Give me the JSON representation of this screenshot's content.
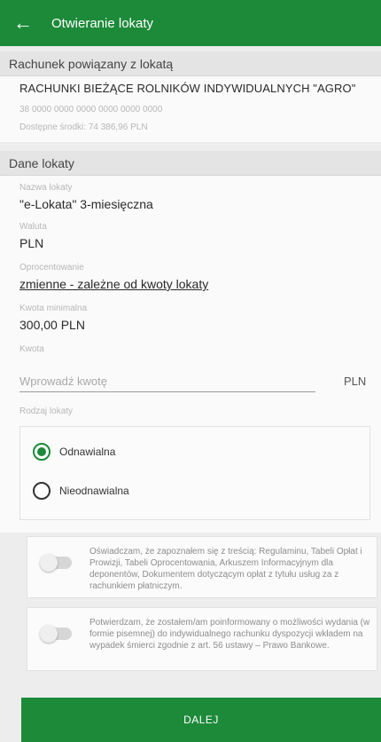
{
  "header": {
    "title": "Otwieranie lokaty",
    "back_icon": "arrow-left-icon"
  },
  "account_section": {
    "heading": "Rachunek powiązany z lokatą",
    "account_name": "RACHUNKI BIEŻĄCE ROLNIKÓW INDYWIDUALNYCH \"AGRO\"",
    "account_number": "38 0000 0000 0000 0000 0000 0000",
    "available_funds": "Dostępne środki: 74 386,96 PLN"
  },
  "deposit_section": {
    "heading": "Dane lokaty",
    "name_label": "Nazwa lokaty",
    "name_value": "\"e-Lokata\" 3-miesięczna",
    "currency_label": "Waluta",
    "currency_value": "PLN",
    "interest_label": "Oprocentowanie",
    "interest_value": "zmienne - zależne od kwoty lokaty",
    "min_amount_label": "Kwota minimalna",
    "min_amount_value": "300,00 PLN",
    "amount_label": "Kwota",
    "amount_placeholder": "Wprowadź kwotę",
    "amount_currency": "PLN",
    "type_label": "Rodzaj lokaty",
    "types": [
      {
        "label": "Odnawialna",
        "selected": true
      },
      {
        "label": "Nieodnawialna",
        "selected": false
      }
    ]
  },
  "consents": [
    {
      "text": "Oświadczam, że zapoznałem się z treścią: Regulaminu, Tabeli Opłat i Prowizji, Tabeli Oprocentowania, Arkuszem Informacyjnym dla deponentów, Dokumentem dotyczącym opłat z tytułu usług za z rachunkiem płatniczym.",
      "checked": false
    },
    {
      "text": "Potwierdzam, że zostałem/am poinformowany o możliwości wydania (w formie pisemnej) do indywidualnego rachunku dyspozycji wkładem na wypadek śmierci zgodnie z art. 56 ustawy – Prawo Bankowe.",
      "checked": false
    }
  ],
  "footer": {
    "next_label": "DALEJ"
  },
  "colors": {
    "brand_green": "#1d8a3a",
    "background": "#ededed"
  }
}
